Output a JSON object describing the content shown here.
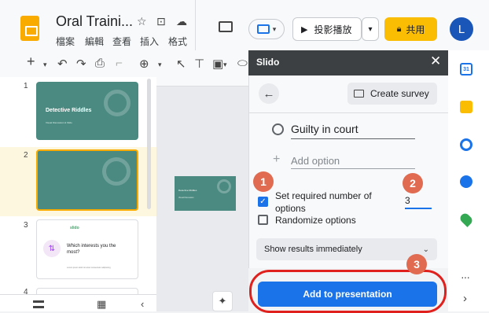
{
  "header": {
    "doc_title": "Oral Traini...",
    "menus": [
      "檔案",
      "編輯",
      "查看",
      "插入",
      "格式"
    ],
    "present_label": "投影播放",
    "share_label": "共用",
    "avatar_letter": "L"
  },
  "slides": [
    {
      "number": "1",
      "title": "Detective Riddles",
      "subtitle": "Visual Discussion & Slido"
    },
    {
      "number": "2"
    },
    {
      "number": "3",
      "logo": "slido",
      "question": "Which interests you the most?",
      "caption": "Lorem ipsum dolor sit amet consectetur adipiscing"
    },
    {
      "number": "4"
    }
  ],
  "canvas": {
    "mini_title": "Detective Riddles",
    "mini_sub": "Visual Discussion"
  },
  "panel": {
    "title": "Slido",
    "create_survey_label": "Create survey",
    "option_text": "Guilty in court",
    "add_option_placeholder": "Add option",
    "required_label": "Set required number of options",
    "required_value": "3",
    "randomize_label": "Randomize options",
    "show_results": "Show results immediately",
    "add_button": "Add to presentation"
  },
  "annotations": {
    "badge1": "1",
    "badge2": "2",
    "badge3": "3"
  },
  "colors": {
    "accent": "#1a73e8",
    "badge": "#e06b50",
    "callout": "#e0201c",
    "share": "#fbbc04",
    "teal": "#4a8a80"
  }
}
